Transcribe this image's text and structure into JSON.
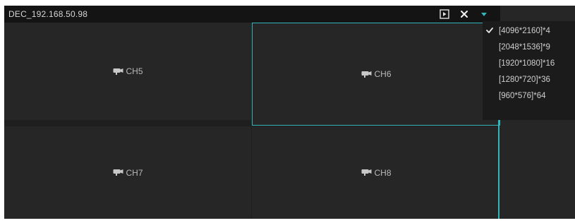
{
  "window": {
    "title": "DEC_192.168.50.98",
    "buttons": {
      "window_icon": "window-icon",
      "close_icon": "close-icon",
      "dropdown_icon": "dropdown-arrow-icon"
    }
  },
  "grid": {
    "cells": [
      {
        "label": "CH5",
        "selected": false
      },
      {
        "label": "CH6",
        "selected": true
      },
      {
        "label": "CH7",
        "selected": false
      },
      {
        "label": "CH8",
        "selected": false
      }
    ]
  },
  "dropdown": {
    "items": [
      {
        "label": "[4096*2160]*4",
        "checked": true
      },
      {
        "label": "[2048*1536]*9",
        "checked": false
      },
      {
        "label": "[1920*1080]*16",
        "checked": false
      },
      {
        "label": "[1280*720]*36",
        "checked": false
      },
      {
        "label": "[960*576]*64",
        "checked": false
      }
    ]
  },
  "colors": {
    "accent": "#2fb7b9",
    "background": "#1f1f1f",
    "cell": "#262626",
    "text": "#d6d6d6"
  }
}
